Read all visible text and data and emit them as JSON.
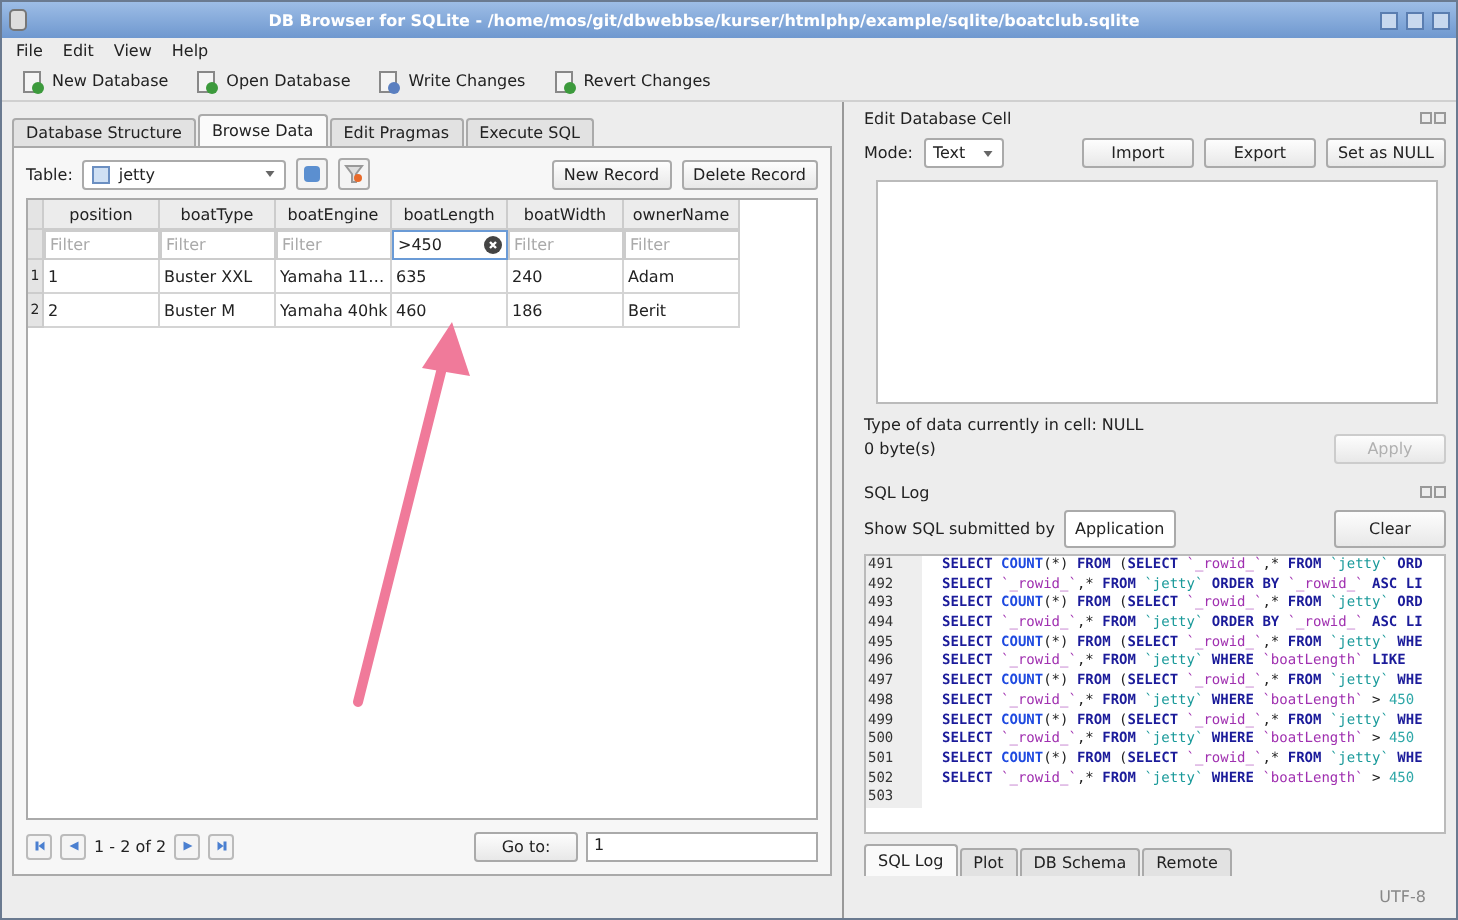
{
  "window": {
    "title": "DB Browser for SQLite - /home/mos/git/dbwebbse/kurser/htmlphp/example/sqlite/boatclub.sqlite"
  },
  "menu": [
    "File",
    "Edit",
    "View",
    "Help"
  ],
  "toolbar": [
    "New Database",
    "Open Database",
    "Write Changes",
    "Revert Changes"
  ],
  "tabs": [
    {
      "label": "Database Structure",
      "selected": false
    },
    {
      "label": "Browse Data",
      "selected": true
    },
    {
      "label": "Edit Pragmas",
      "selected": false
    },
    {
      "label": "Execute SQL",
      "selected": false
    }
  ],
  "browse": {
    "table_label": "Table:",
    "table_value": "jetty",
    "buttons": [
      "New Record",
      "Delete Record"
    ],
    "columns": [
      "position",
      "boatType",
      "boatEngine",
      "boatLength",
      "boatWidth",
      "ownerName"
    ],
    "filters": [
      {
        "placeholder": "Filter"
      },
      {
        "placeholder": "Filter"
      },
      {
        "placeholder": "Filter"
      },
      {
        "value": ">450"
      },
      {
        "placeholder": "Filter"
      },
      {
        "placeholder": "Filter"
      }
    ],
    "rows": [
      {
        "number": "1",
        "cells": [
          "1",
          "Buster XXL",
          "Yamaha 11…",
          "635",
          "240",
          "Adam"
        ]
      },
      {
        "number": "2",
        "cells": [
          "2",
          "Buster M",
          "Yamaha 40hk",
          "460",
          "186",
          "Berit"
        ]
      }
    ],
    "pager": {
      "range": "1 - 2 of 2",
      "goto_button": "Go to:",
      "goto_value": "1"
    }
  },
  "edit_cell": {
    "title": "Edit Database Cell",
    "mode_label": "Mode:",
    "mode_value": "Text",
    "buttons": [
      "Import",
      "Export",
      "Set as NULL"
    ],
    "type_info": "Type of data currently in cell: NULL",
    "size_info": "0 byte(s)",
    "apply": {
      "label": "Apply",
      "disabled": true
    }
  },
  "sql_log": {
    "title": "SQL Log",
    "filter_label": "Show SQL submitted by",
    "filter_value": "Application",
    "clear": "Clear",
    "lines": [
      {
        "number": "491",
        "tokens": [
          {
            "kind": "kw",
            "text": "SELECT "
          },
          {
            "kind": "fn",
            "text": "COUNT"
          },
          {
            "kind": "p",
            "text": "(*) "
          },
          {
            "kind": "kw",
            "text": "FROM "
          },
          {
            "kind": "p",
            "text": "("
          },
          {
            "kind": "kw",
            "text": "SELECT "
          },
          {
            "kind": "id",
            "text": "`_rowid_`"
          },
          {
            "kind": "p",
            "text": ",* "
          },
          {
            "kind": "kw",
            "text": "FROM "
          },
          {
            "kind": "tb",
            "text": "`jetty` "
          },
          {
            "kind": "kw",
            "text": "ORD"
          }
        ]
      },
      {
        "number": "492",
        "tokens": [
          {
            "kind": "kw",
            "text": "SELECT "
          },
          {
            "kind": "id",
            "text": "`_rowid_`"
          },
          {
            "kind": "p",
            "text": ",* "
          },
          {
            "kind": "kw",
            "text": "FROM "
          },
          {
            "kind": "tb",
            "text": "`jetty` "
          },
          {
            "kind": "kw",
            "text": "ORDER BY "
          },
          {
            "kind": "id",
            "text": "`_rowid_` "
          },
          {
            "kind": "kw",
            "text": "ASC LI"
          }
        ]
      },
      {
        "number": "493",
        "tokens": [
          {
            "kind": "kw",
            "text": "SELECT "
          },
          {
            "kind": "fn",
            "text": "COUNT"
          },
          {
            "kind": "p",
            "text": "(*) "
          },
          {
            "kind": "kw",
            "text": "FROM "
          },
          {
            "kind": "p",
            "text": "("
          },
          {
            "kind": "kw",
            "text": "SELECT "
          },
          {
            "kind": "id",
            "text": "`_rowid_`"
          },
          {
            "kind": "p",
            "text": ",* "
          },
          {
            "kind": "kw",
            "text": "FROM "
          },
          {
            "kind": "tb",
            "text": "`jetty` "
          },
          {
            "kind": "kw",
            "text": "ORD"
          }
        ]
      },
      {
        "number": "494",
        "tokens": [
          {
            "kind": "kw",
            "text": "SELECT "
          },
          {
            "kind": "id",
            "text": "`_rowid_`"
          },
          {
            "kind": "p",
            "text": ",* "
          },
          {
            "kind": "kw",
            "text": "FROM "
          },
          {
            "kind": "tb",
            "text": "`jetty` "
          },
          {
            "kind": "kw",
            "text": "ORDER BY "
          },
          {
            "kind": "id",
            "text": "`_rowid_` "
          },
          {
            "kind": "kw",
            "text": "ASC LI"
          }
        ]
      },
      {
        "number": "495",
        "tokens": [
          {
            "kind": "kw",
            "text": "SELECT "
          },
          {
            "kind": "fn",
            "text": "COUNT"
          },
          {
            "kind": "p",
            "text": "(*) "
          },
          {
            "kind": "kw",
            "text": "FROM "
          },
          {
            "kind": "p",
            "text": "("
          },
          {
            "kind": "kw",
            "text": "SELECT "
          },
          {
            "kind": "id",
            "text": "`_rowid_`"
          },
          {
            "kind": "p",
            "text": ",* "
          },
          {
            "kind": "kw",
            "text": "FROM "
          },
          {
            "kind": "tb",
            "text": "`jetty` "
          },
          {
            "kind": "kw",
            "text": "WHE"
          }
        ]
      },
      {
        "number": "496",
        "tokens": [
          {
            "kind": "kw",
            "text": "SELECT "
          },
          {
            "kind": "id",
            "text": "`_rowid_`"
          },
          {
            "kind": "p",
            "text": ",* "
          },
          {
            "kind": "kw",
            "text": "FROM "
          },
          {
            "kind": "tb",
            "text": "`jetty` "
          },
          {
            "kind": "kw",
            "text": "WHERE "
          },
          {
            "kind": "id",
            "text": "`boatLength` "
          },
          {
            "kind": "kw",
            "text": "LIKE"
          }
        ]
      },
      {
        "number": "497",
        "tokens": [
          {
            "kind": "kw",
            "text": "SELECT "
          },
          {
            "kind": "fn",
            "text": "COUNT"
          },
          {
            "kind": "p",
            "text": "(*) "
          },
          {
            "kind": "kw",
            "text": "FROM "
          },
          {
            "kind": "p",
            "text": "("
          },
          {
            "kind": "kw",
            "text": "SELECT "
          },
          {
            "kind": "id",
            "text": "`_rowid_`"
          },
          {
            "kind": "p",
            "text": ",* "
          },
          {
            "kind": "kw",
            "text": "FROM "
          },
          {
            "kind": "tb",
            "text": "`jetty` "
          },
          {
            "kind": "kw",
            "text": "WHE"
          }
        ]
      },
      {
        "number": "498",
        "tokens": [
          {
            "kind": "kw",
            "text": "SELECT "
          },
          {
            "kind": "id",
            "text": "`_rowid_`"
          },
          {
            "kind": "p",
            "text": ",* "
          },
          {
            "kind": "kw",
            "text": "FROM "
          },
          {
            "kind": "tb",
            "text": "`jetty` "
          },
          {
            "kind": "kw",
            "text": "WHERE "
          },
          {
            "kind": "id",
            "text": "`boatLength` "
          },
          {
            "kind": "p",
            "text": "> "
          },
          {
            "kind": "num",
            "text": "450"
          }
        ]
      },
      {
        "number": "499",
        "tokens": [
          {
            "kind": "kw",
            "text": "SELECT "
          },
          {
            "kind": "fn",
            "text": "COUNT"
          },
          {
            "kind": "p",
            "text": "(*) "
          },
          {
            "kind": "kw",
            "text": "FROM "
          },
          {
            "kind": "p",
            "text": "("
          },
          {
            "kind": "kw",
            "text": "SELECT "
          },
          {
            "kind": "id",
            "text": "`_rowid_`"
          },
          {
            "kind": "p",
            "text": ",* "
          },
          {
            "kind": "kw",
            "text": "FROM "
          },
          {
            "kind": "tb",
            "text": "`jetty` "
          },
          {
            "kind": "kw",
            "text": "WHE"
          }
        ]
      },
      {
        "number": "500",
        "tokens": [
          {
            "kind": "kw",
            "text": "SELECT "
          },
          {
            "kind": "id",
            "text": "`_rowid_`"
          },
          {
            "kind": "p",
            "text": ",* "
          },
          {
            "kind": "kw",
            "text": "FROM "
          },
          {
            "kind": "tb",
            "text": "`jetty` "
          },
          {
            "kind": "kw",
            "text": "WHERE "
          },
          {
            "kind": "id",
            "text": "`boatLength` "
          },
          {
            "kind": "p",
            "text": "> "
          },
          {
            "kind": "num",
            "text": "450"
          }
        ]
      },
      {
        "number": "501",
        "tokens": [
          {
            "kind": "kw",
            "text": "SELECT "
          },
          {
            "kind": "fn",
            "text": "COUNT"
          },
          {
            "kind": "p",
            "text": "(*) "
          },
          {
            "kind": "kw",
            "text": "FROM "
          },
          {
            "kind": "p",
            "text": "("
          },
          {
            "kind": "kw",
            "text": "SELECT "
          },
          {
            "kind": "id",
            "text": "`_rowid_`"
          },
          {
            "kind": "p",
            "text": ",* "
          },
          {
            "kind": "kw",
            "text": "FROM "
          },
          {
            "kind": "tb",
            "text": "`jetty` "
          },
          {
            "kind": "kw",
            "text": "WHE"
          }
        ]
      },
      {
        "number": "502",
        "tokens": [
          {
            "kind": "kw",
            "text": "SELECT "
          },
          {
            "kind": "id",
            "text": "`_rowid_`"
          },
          {
            "kind": "p",
            "text": ",* "
          },
          {
            "kind": "kw",
            "text": "FROM "
          },
          {
            "kind": "tb",
            "text": "`jetty` "
          },
          {
            "kind": "kw",
            "text": "WHERE "
          },
          {
            "kind": "id",
            "text": "`boatLength` "
          },
          {
            "kind": "p",
            "text": "> "
          },
          {
            "kind": "num",
            "text": "450"
          }
        ]
      },
      {
        "number": "503"
      }
    ],
    "tabs": [
      {
        "label": "SQL Log",
        "selected": true
      },
      {
        "label": "Plot",
        "selected": false
      },
      {
        "label": "DB Schema",
        "selected": false
      },
      {
        "label": "Remote",
        "selected": false
      }
    ]
  },
  "status": "UTF-8"
}
